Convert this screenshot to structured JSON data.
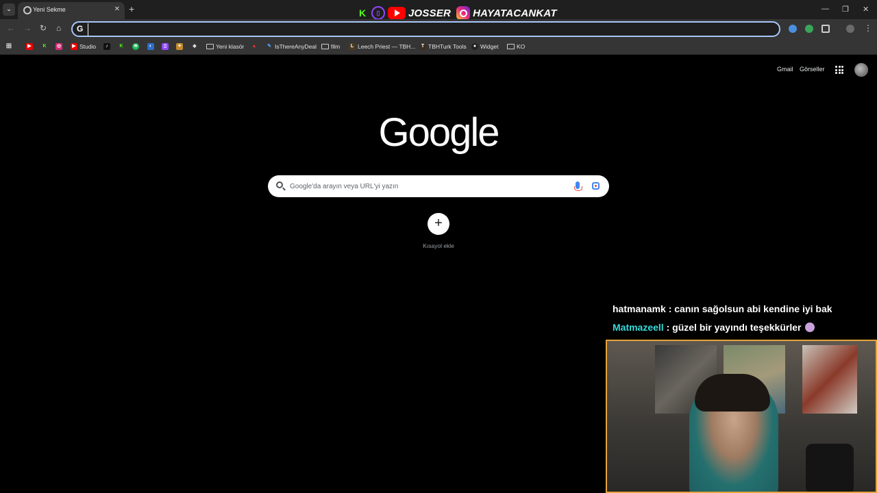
{
  "browser": {
    "tab": {
      "title": "Yeni Sekme",
      "close": "✕"
    },
    "new_tab": "+",
    "window": {
      "minimize": "—",
      "restore": "❐",
      "close": "✕"
    }
  },
  "overlay_brand": {
    "youtube_name": "JOSSER",
    "instagram_name": "HAYATACANKAT"
  },
  "toolbar": {
    "back": "←",
    "forward": "→",
    "reload": "↻",
    "home": "⌂",
    "omnibox_value": ""
  },
  "bookmarks": [
    {
      "label": "Studio"
    },
    {
      "label": "Yeni klasör"
    },
    {
      "label": "IsThereAnyDeal"
    },
    {
      "label": "film"
    },
    {
      "label": "Leech Priest — TBH..."
    },
    {
      "label": "TBHTurk Tools"
    },
    {
      "label": "Widget"
    },
    {
      "label": "KO"
    }
  ],
  "google": {
    "gmail": "Gmail",
    "images": "Görseller",
    "logo": "Google",
    "search_placeholder": "Google'da arayın veya URL'yi yazın",
    "add_shortcut_label": "Kısayol ekle",
    "add_shortcut_symbol": "+"
  },
  "chat": [
    {
      "user": "hatmanamk",
      "separator": " : ",
      "message": "canın sağolsun abi kendine iyi bak"
    },
    {
      "user": "Matmazeell",
      "separator": " : ",
      "message": "güzel bir yayındı teşekkürler"
    }
  ],
  "colors": {
    "omnibox_focus": "#a8c7fa",
    "webcam_border": "#e9a43a",
    "chat_highlight": "#38d9d9"
  }
}
